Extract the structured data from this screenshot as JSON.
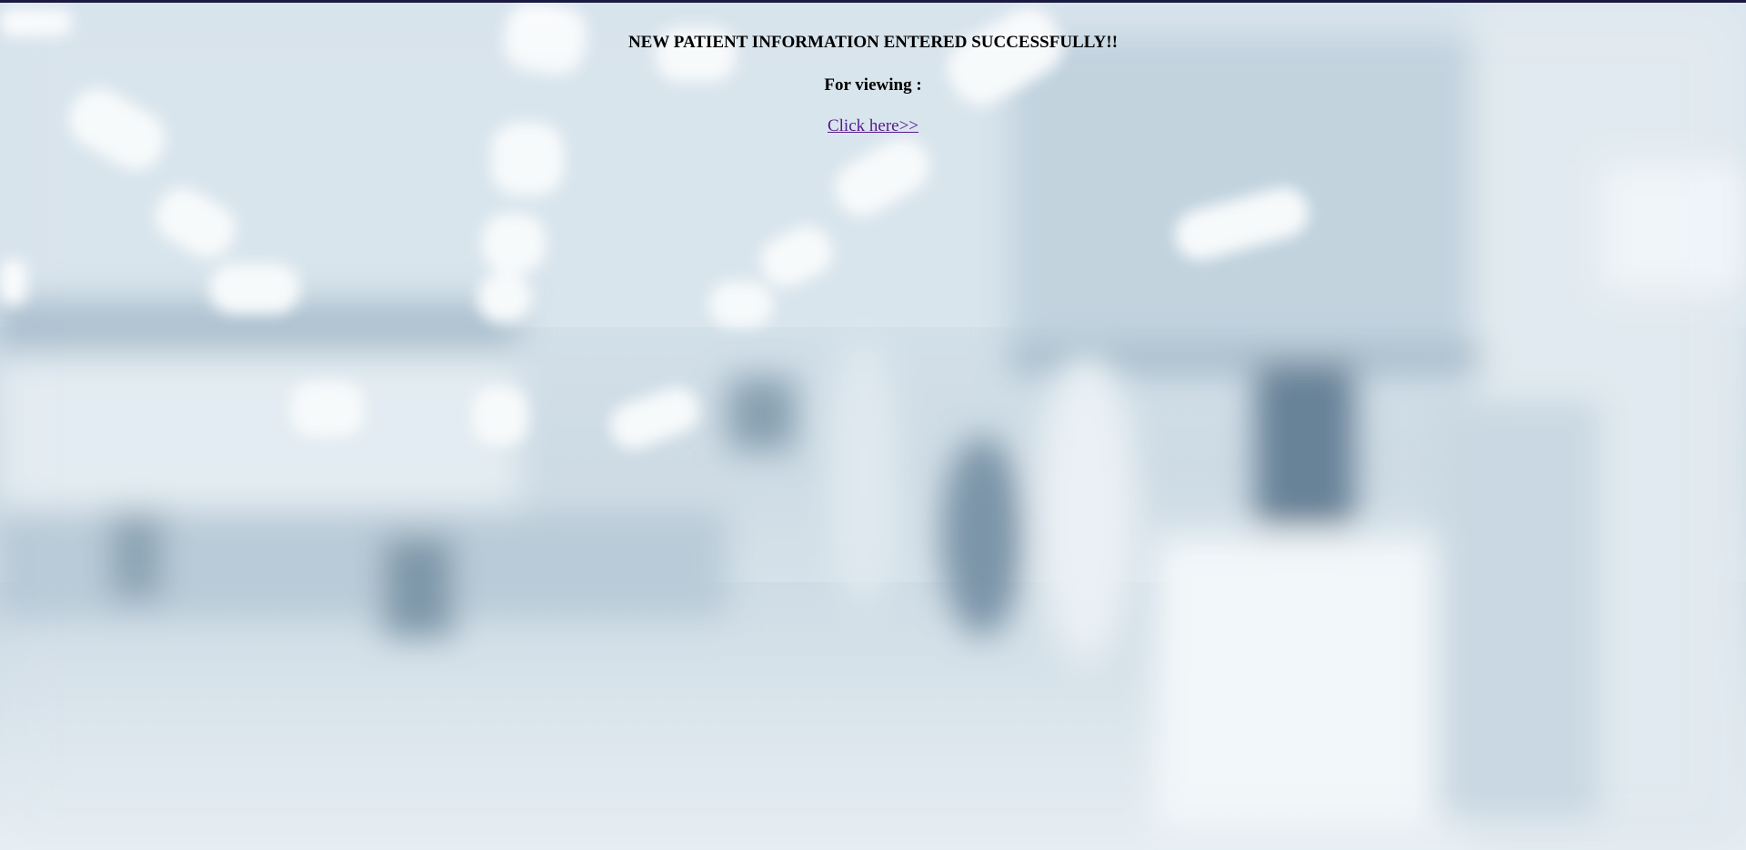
{
  "message": {
    "success": "NEW PATIENT INFORMATION ENTERED SUCCESSFULLY!!",
    "for_viewing": "For viewing :",
    "link_label": "Click here>>"
  },
  "background": {
    "description_icon": "blurred-hospital-corridor-image",
    "tint": "#cfdde8"
  },
  "colors": {
    "link_visited": "#551a8b",
    "top_border": "#1a1a40"
  }
}
